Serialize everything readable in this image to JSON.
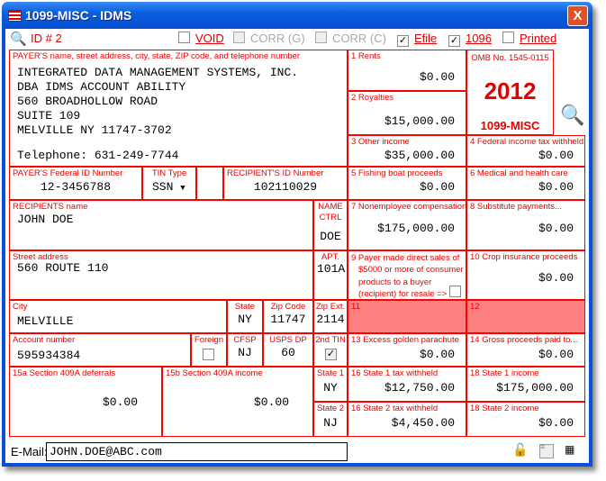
{
  "window": {
    "title": "1099-MISC - IDMS",
    "close": "X"
  },
  "toolbar": {
    "id": "ID # 2",
    "void": "VOID",
    "corr_g": "CORR (G)",
    "corr_c": "CORR (C)",
    "efile": "Efile",
    "f1096": "1096",
    "printed": "Printed",
    "efile_checked": true,
    "f1096_checked": true
  },
  "payer": {
    "label": "PAYER'S name, street address, city, state, ZIP code, and telephone number",
    "lines": [
      "INTEGRATED DATA MANAGEMENT SYSTEMS, INC.",
      "DBA IDMS ACCOUNT ABILITY",
      "560 BROADHOLLOW ROAD",
      "SUITE 109",
      "MELVILLE NY 11747-3702"
    ],
    "phone": "Telephone: 631-249-7744"
  },
  "omb": {
    "label": "OMB No. 1545-0115",
    "year": "2012",
    "form": "1099-MISC"
  },
  "boxes": {
    "b1": {
      "label": "1 Rents",
      "value": "$0.00"
    },
    "b2": {
      "label": "2 Royalties",
      "value": "$15,000.00"
    },
    "b3": {
      "label": "3 Other income",
      "value": "$35,000.00"
    },
    "b4": {
      "label": "4 Federal income tax withheld",
      "value": "$0.00"
    },
    "b5": {
      "label": "5 Fishing boat proceeds",
      "value": "$0.00"
    },
    "b6": {
      "label": "6 Medical and health care",
      "value": "$0.00"
    },
    "b7": {
      "label": "7 Nonemployee compensation",
      "value": "$175,000.00"
    },
    "b8": {
      "label": "8 Substitute payments...",
      "value": "$0.00"
    },
    "b9": {
      "label_lines": [
        "9 Payer made direct sales of",
        "$5000 or more of consumer",
        "products to a buyer",
        "(recipient) for resale =>"
      ]
    },
    "b10": {
      "label": "10 Crop insurance proceeds",
      "value": "$0.00"
    },
    "b11": {
      "label": "11"
    },
    "b12": {
      "label": "12"
    },
    "b13": {
      "label": "13 Excess golden parachute",
      "value": "$0.00"
    },
    "b14": {
      "label": "14 Gross proceeds paid to...",
      "value": "$0.00"
    },
    "b15a": {
      "label": "15a Section 409A deferrals",
      "value": "$0.00"
    },
    "b15b": {
      "label": "15b Section 409A income",
      "value": "$0.00"
    },
    "b16_1": {
      "label": "16 State 1 tax withheld",
      "value": "$12,750.00"
    },
    "b16_2": {
      "label": "16 State 2 tax withheld",
      "value": "$4,450.00"
    },
    "b18_1": {
      "label": "18 State 1 income",
      "value": "$175,000.00"
    },
    "b18_2": {
      "label": "18 State 2 income",
      "value": "$0.00"
    }
  },
  "fields": {
    "payer_fid": {
      "label": "PAYER'S Federal ID Number",
      "value": "12-3456788"
    },
    "tin_type": {
      "label": "TIN Type",
      "value": "SSN"
    },
    "recip_id": {
      "label": "RECIPIENT'S ID Number",
      "value": "102110029"
    },
    "recip_name": {
      "label": "RECIPIENTS name",
      "value": "JOHN DOE"
    },
    "name_ctrl": {
      "label1": "NAME",
      "label2": "CTRL",
      "value": "DOE"
    },
    "street": {
      "label": "Street address",
      "value": "560 ROUTE 110"
    },
    "apt": {
      "label": "APT.",
      "value": "101A"
    },
    "city": {
      "label": "City",
      "value": "MELVILLE"
    },
    "state": {
      "label": "State",
      "value": "NY"
    },
    "zip": {
      "label": "Zip Code",
      "value": "11747"
    },
    "zipext": {
      "label": "Zip Ext.",
      "value": "2114"
    },
    "account": {
      "label": "Account number",
      "value": "595934384"
    },
    "foreign": {
      "label": "Foreign"
    },
    "cfsp": {
      "label": "CFSP",
      "value": "NJ"
    },
    "usps": {
      "label": "USPS DP",
      "value": "60"
    },
    "tin2": {
      "label": "2nd TIN",
      "checked": true
    },
    "state1": {
      "label": "State 1",
      "value": "NY"
    },
    "state2": {
      "label": "State 2",
      "value": "NJ"
    }
  },
  "email": {
    "label": "E-Mail:",
    "value": "JOHN.DOE@ABC.com"
  }
}
